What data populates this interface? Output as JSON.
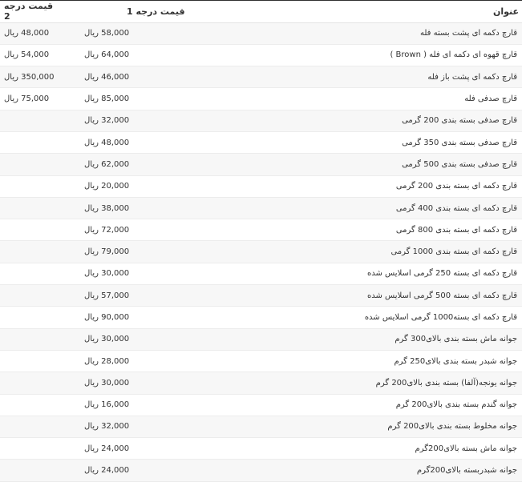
{
  "table": {
    "headers": {
      "title": "عنوان",
      "price1": "قیمت درجه 1",
      "price2": "قیمت درجه 2"
    },
    "rows": [
      {
        "title": "قارچ دکمه ای پشت بسته فله",
        "price1": "58,000 ریال",
        "price2": "48,000 ریال"
      },
      {
        "title": "قارچ قهوه ای دکمه ای فله ( Brown )",
        "price1": "64,000 ریال",
        "price2": "54,000 ریال"
      },
      {
        "title": "قارچ دکمه ای پشت باز فله",
        "price1": "46,000 ریال",
        "price2": "350,000 ریال"
      },
      {
        "title": "قارچ صدفی فله",
        "price1": "85,000 ریال",
        "price2": "75,000 ریال"
      },
      {
        "title": "قارچ صدفی بسته بندی 200 گرمی",
        "price1": "32,000 ریال",
        "price2": ""
      },
      {
        "title": "قارچ صدفی بسته بندی 350 گرمی",
        "price1": "48,000 ریال",
        "price2": ""
      },
      {
        "title": "قارچ صدفی بسته بندی 500 گرمی",
        "price1": "62,000 ریال",
        "price2": ""
      },
      {
        "title": "قارچ دکمه ای بسته بندی 200 گرمی",
        "price1": "20,000 ریال",
        "price2": ""
      },
      {
        "title": "قارچ دکمه ای بسته بندی 400 گرمی",
        "price1": "38,000 ریال",
        "price2": ""
      },
      {
        "title": "قارچ دکمه ای بسته بندی 800 گرمی",
        "price1": "72,000 ریال",
        "price2": ""
      },
      {
        "title": "قارچ دکمه ای بسته بندی 1000 گرمی",
        "price1": "79,000 ریال",
        "price2": ""
      },
      {
        "title": "قارچ دکمه ای بسته 250 گرمی اسلایس شده",
        "price1": "30,000 ریال",
        "price2": ""
      },
      {
        "title": "قارچ دکمه ای بسته 500 گرمی اسلایس شده",
        "price1": "57,000 ریال",
        "price2": ""
      },
      {
        "title": "قارچ دکمه ای بسته1000 گرمی اسلایس شده",
        "price1": "90,000 ریال",
        "price2": ""
      },
      {
        "title": "جوانه ماش بسته بندی بالای300 گرم",
        "price1": "30,000 ریال",
        "price2": ""
      },
      {
        "title": "جوانه شبدر بسته بندی بالای250 گرم",
        "price1": "28,000 ریال",
        "price2": ""
      },
      {
        "title": "جوانه یونجه(آلفا) بسته بندی بالای200 گرم",
        "price1": "30,000 ریال",
        "price2": ""
      },
      {
        "title": "جوانه گندم بسته بندی بالای200 گرم",
        "price1": "16,000 ریال",
        "price2": ""
      },
      {
        "title": "جوانه مخلوط بسته بندی بالای200 گرم",
        "price1": "32,000 ریال",
        "price2": ""
      },
      {
        "title": "جوانه ماش بسته بالای200گرم",
        "price1": "24,000 ریال",
        "price2": ""
      },
      {
        "title": "جوانه شبدربسته بالای200گرم",
        "price1": "24,000 ریال",
        "price2": ""
      }
    ]
  }
}
